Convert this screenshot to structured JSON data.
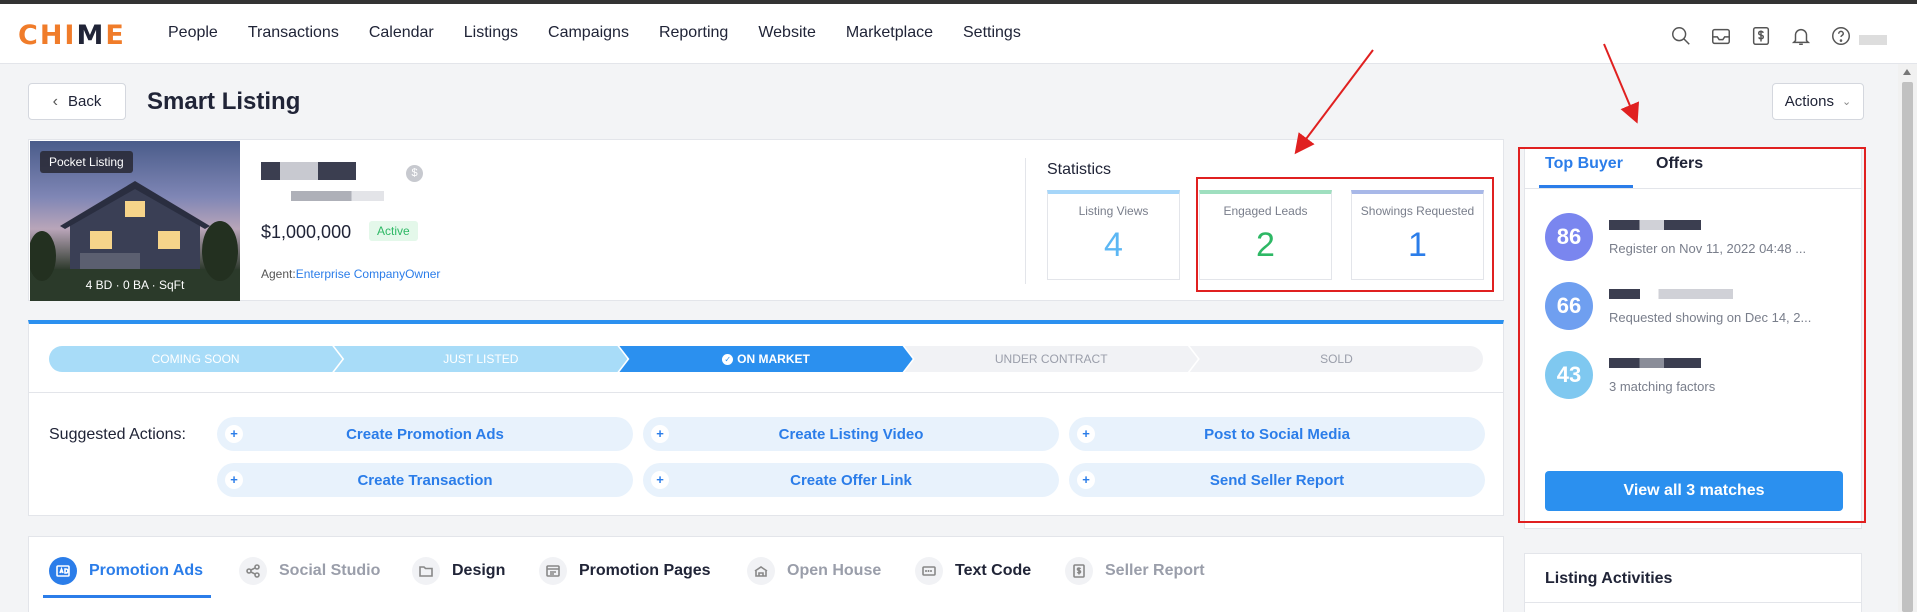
{
  "brand": {
    "logo_text_a": "CHI",
    "logo_text_m": "M",
    "logo_text_b": "E"
  },
  "nav": {
    "items": [
      "People",
      "Transactions",
      "Calendar",
      "Listings",
      "Campaigns",
      "Reporting",
      "Website",
      "Marketplace",
      "Settings"
    ],
    "icons": [
      "search-icon",
      "inbox-icon",
      "dollar-icon",
      "bell-icon",
      "help-icon"
    ]
  },
  "header": {
    "back_label": "Back",
    "title": "Smart Listing",
    "actions_label": "Actions"
  },
  "listing": {
    "badge": "Pocket Listing",
    "photo_stats": "4 BD · 0 BA · SqFt",
    "price": "$1,000,000",
    "status": "Active",
    "agent_prefix": "Agent:",
    "agent_name": "Enterprise CompanyOwner"
  },
  "statistics": {
    "title": "Statistics",
    "items": [
      {
        "label": "Listing Views",
        "value": "4"
      },
      {
        "label": "Engaged Leads",
        "value": "2"
      },
      {
        "label": "Showings Requested",
        "value": "1"
      }
    ]
  },
  "stages": [
    "COMING SOON",
    "JUST LISTED",
    "ON MARKET",
    "UNDER CONTRACT",
    "SOLD"
  ],
  "suggested": {
    "label": "Suggested Actions:",
    "actions": [
      "Create Promotion Ads",
      "Create Listing Video",
      "Post to Social Media",
      "Create Transaction",
      "Create Offer Link",
      "Send Seller Report"
    ]
  },
  "tabs": [
    "Promotion Ads",
    "Social Studio",
    "Design",
    "Promotion Pages",
    "Open House",
    "Text Code",
    "Seller Report"
  ],
  "top_buyer": {
    "tabs": [
      "Top Buyer",
      "Offers"
    ],
    "buyers": [
      {
        "score": "86",
        "desc": "Register on Nov 11, 2022 04:48 ...",
        "color": "#7a86ef"
      },
      {
        "score": "66",
        "desc": "Requested showing on Dec 14, 2...",
        "color": "#6f9ff0"
      },
      {
        "score": "43",
        "desc": "3 matching factors",
        "color": "#7fc8f0"
      }
    ],
    "view_all": "View all 3 matches"
  },
  "activities": {
    "title": "Listing Activities"
  },
  "colors": {
    "accent": "#2b7de9",
    "annotation": "#e02020"
  }
}
